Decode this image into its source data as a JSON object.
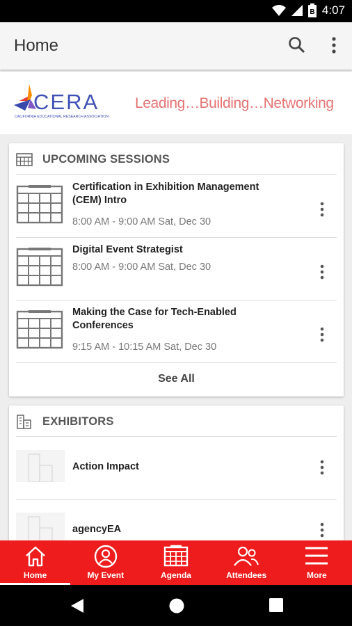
{
  "status_bar": {
    "time": "4:07"
  },
  "app_bar": {
    "title": "Home"
  },
  "banner": {
    "logo_text": "CERA",
    "logo_subtitle": "CALIFORNIA EDUCATIONAL RESEARCH ASSOCIATION",
    "tagline": "Leading…Building…Networking"
  },
  "sessions": {
    "header": "UPCOMING SESSIONS",
    "items": [
      {
        "title": "Certification in Exhibition Management (CEM) Intro",
        "time": "8:00 AM - 9:00 AM Sat, Dec 30"
      },
      {
        "title": "Digital Event Strategist",
        "time": "8:00 AM - 9:00 AM Sat, Dec 30"
      },
      {
        "title": "Making the Case for Tech-Enabled Conferences",
        "time": "9:15 AM - 10:15 AM Sat, Dec 30"
      }
    ],
    "see_all": "See All"
  },
  "exhibitors": {
    "header": "EXHIBITORS",
    "items": [
      {
        "name": "Action Impact"
      },
      {
        "name": "agencyEA"
      }
    ]
  },
  "bottom_nav": {
    "items": [
      {
        "label": "Home",
        "icon": "home-icon",
        "active": true
      },
      {
        "label": "My Event",
        "icon": "person-icon",
        "active": false
      },
      {
        "label": "Agenda",
        "icon": "calendar-icon",
        "active": false
      },
      {
        "label": "Attendees",
        "icon": "people-icon",
        "active": false
      },
      {
        "label": "More",
        "icon": "menu-icon",
        "active": false
      }
    ]
  },
  "colors": {
    "accent": "#ee1c1c",
    "tagline": "#e57373",
    "logo_blue": "#3f51b5"
  }
}
